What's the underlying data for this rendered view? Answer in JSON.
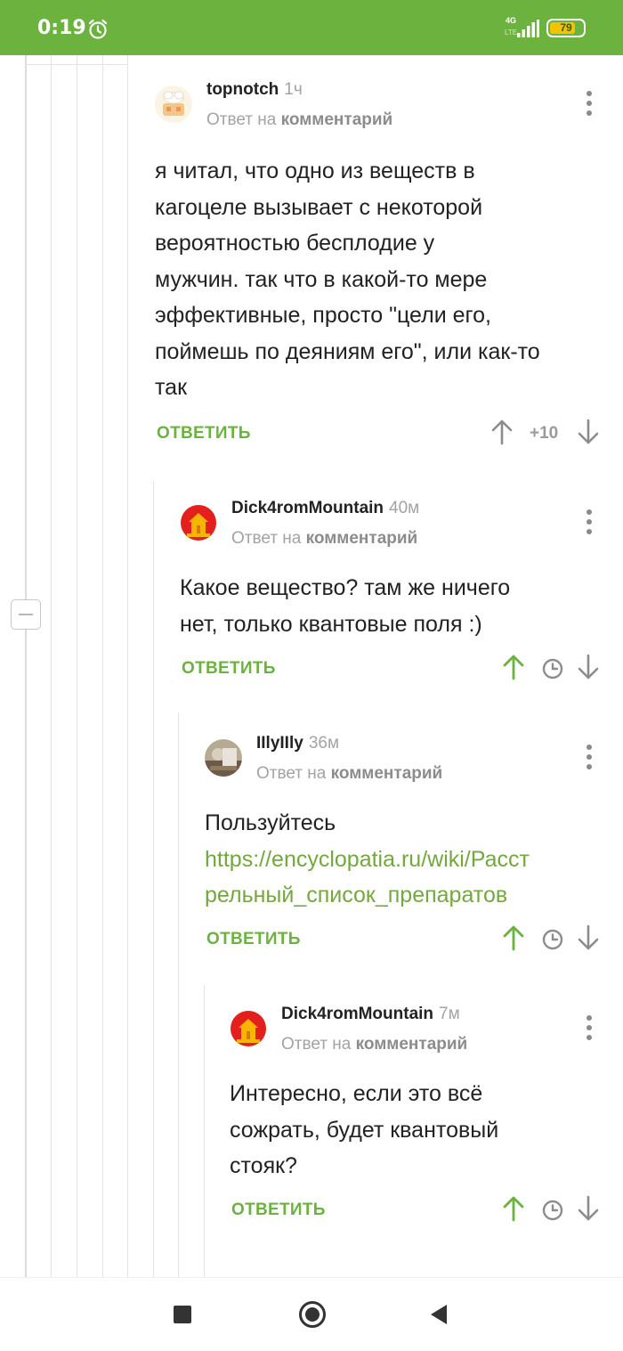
{
  "status": {
    "time": "0:19",
    "network": "4G",
    "network_sub": "LTE",
    "battery": "79",
    "battery_level": 79
  },
  "comments": [
    {
      "user": "topnotch",
      "age": "1ч",
      "reply_prefix": "Ответ на ",
      "reply_target": "комментарий",
      "lines": [
        "я читал, что одно из веществ в",
        "кагоцеле вызывает с некоторой",
        "вероятностью бесплодие у",
        "мужчин. так что в какой-то мере",
        "эффективные, просто \"цели его,",
        "поймешь по деяниям его\", или как-то",
        "так"
      ],
      "answer": "ОТВЕТИТЬ",
      "rating": "+10",
      "avatar": "hat-avatar"
    },
    {
      "user": "Dick4romMountain",
      "age": "40м",
      "reply_prefix": "Ответ на ",
      "reply_target": "комментарий",
      "lines": [
        "Какое вещество? там же ничего",
        "нет, только квантовые поля :)"
      ],
      "answer": "ОТВЕТИТЬ",
      "avatar": "red-circle-avatar"
    },
    {
      "user": "IIlyIIly",
      "age": "36м",
      "reply_prefix": "Ответ на ",
      "reply_target": "комментарий",
      "text": "Пользуйтесь",
      "link_lines": [
        "https://encyclopatia.ru/wiki/Расст",
        "рельный_список_препаратов"
      ],
      "answer": "ОТВЕТИТЬ",
      "avatar": "photo-avatar"
    },
    {
      "user": "Dick4romMountain",
      "age": "7м",
      "reply_prefix": "Ответ на ",
      "reply_target": "комментарий",
      "lines": [
        "Интересно, если это всё",
        "сожрать, будет квантовый",
        "стояк?"
      ],
      "answer": "ОТВЕТИТЬ",
      "avatar": "red-circle-avatar"
    }
  ],
  "colors": {
    "brand_green": "#6cb23f",
    "text": "#222222",
    "muted": "#a3a3a3"
  },
  "icons": [
    "alarm-icon",
    "signal-icon",
    "battery-icon",
    "more-icon",
    "arrow-up-icon",
    "arrow-down-icon",
    "clock-icon",
    "collapse-icon",
    "nav-recents-icon",
    "nav-home-icon",
    "nav-back-icon"
  ]
}
